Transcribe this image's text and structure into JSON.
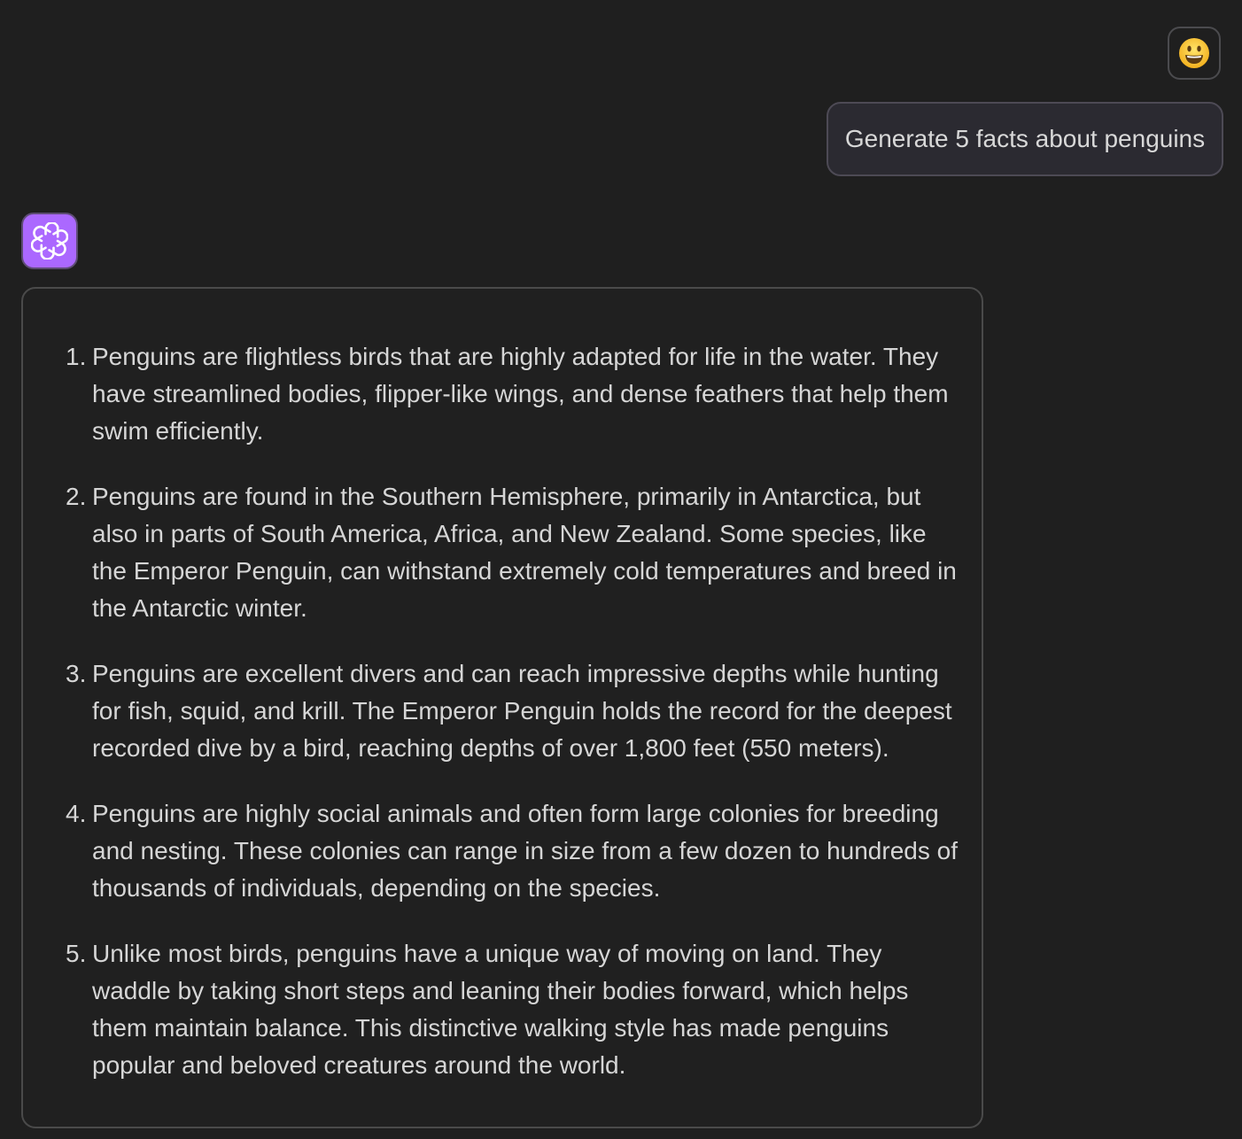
{
  "user": {
    "avatar_emoji": "😃",
    "message": "Generate 5 facts about penguins"
  },
  "assistant": {
    "avatar_color": "#ab68ff",
    "facts": [
      {
        "number": "1.",
        "text": "Penguins are flightless birds that are highly adapted for life in the water. They have streamlined bodies, flipper-like wings, and dense feathers that help them swim efficiently."
      },
      {
        "number": "2.",
        "text": "Penguins are found in the Southern Hemisphere, primarily in Antarctica, but also in parts of South America, Africa, and New Zealand. Some species, like the Emperor Penguin, can withstand extremely cold temperatures and breed in the Antarctic winter."
      },
      {
        "number": "3.",
        "text": "Penguins are excellent divers and can reach impressive depths while hunting for fish, squid, and krill. The Emperor Penguin holds the record for the deepest recorded dive by a bird, reaching depths of over 1,800 feet (550 meters)."
      },
      {
        "number": "4.",
        "text": "Penguins are highly social animals and often form large colonies for breeding and nesting. These colonies can range in size from a few dozen to hundreds of thousands of individuals, depending on the species."
      },
      {
        "number": "5.",
        "text": "Unlike most birds, penguins have a unique way of moving on land. They waddle by taking short steps and leaning their bodies forward, which helps them maintain balance. This distinctive walking style has made penguins popular and beloved creatures around the world."
      }
    ]
  },
  "colors": {
    "background": "#1f1f1f",
    "user_bubble": "#2b2a31",
    "assistant_avatar": "#ab68ff",
    "text": "#d6d6d6"
  }
}
